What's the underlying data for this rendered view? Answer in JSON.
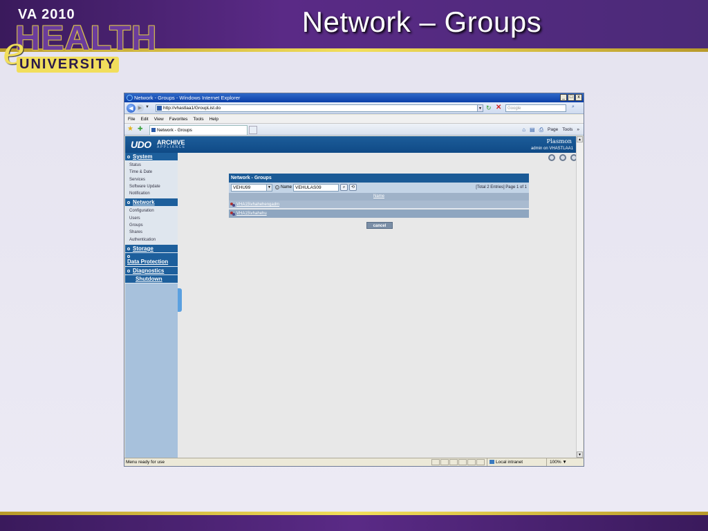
{
  "slide": {
    "title": "Network – Groups",
    "logo": {
      "va_year": "VA 2010",
      "e": "e",
      "health": "HEALTH",
      "university": "UNIVERSITY"
    },
    "colors": {
      "header": "#4b2a78",
      "accent_line": "#f2de5a",
      "background": "#e8e6f2"
    }
  },
  "browser": {
    "window_title": "Network - Groups - Windows Internet Explorer",
    "win_buttons": {
      "minimize": "_",
      "maximize": "□",
      "close": "x"
    },
    "url": "http://vhastlaa1/GroupList.do",
    "search_placeholder": "Google",
    "menu": [
      "File",
      "Edit",
      "View",
      "Favorites",
      "Tools",
      "Help"
    ],
    "tab_label": "Network - Groups",
    "command_bar": {
      "home": "⌂",
      "feeds": "▤",
      "print": "⎙",
      "page": "Page",
      "tools": "Tools",
      "more": "»"
    },
    "status_text": "Menu ready for use",
    "zone": "Local intranet",
    "zoom": "100%"
  },
  "app": {
    "brand": {
      "udo": "UDO",
      "archive": "ARCHIVE",
      "appliance": "APPLIANCE",
      "vendor": "Plasmon"
    },
    "user_line": "admin on VHASTLAA1",
    "sidebar": {
      "system": {
        "label": "System",
        "items": [
          "Status",
          "Time & Date",
          "Services",
          "Software Update",
          "Notification"
        ]
      },
      "network": {
        "label": "Network",
        "items": [
          "Configuration",
          "Users",
          "Groups",
          "Shares",
          "Authentication"
        ]
      },
      "storage": {
        "label": "Storage"
      },
      "data_protection": {
        "label": "Data Protection"
      },
      "diagnostics": {
        "label": "Diagnostics"
      },
      "shutdown": {
        "label": "Shutdown"
      }
    },
    "groups_panel": {
      "title": "Network - Groups",
      "domain_select": "VEHU99",
      "name_label": "Name",
      "name_value": "VEHULAS09",
      "total": "[Total 2 Entries] Page 1 of 1",
      "column_header": "Name",
      "rows": [
        "VHA15\\vhahehengadm",
        "VHA15\\vhahehu"
      ],
      "cancel_label": "cancel"
    }
  }
}
